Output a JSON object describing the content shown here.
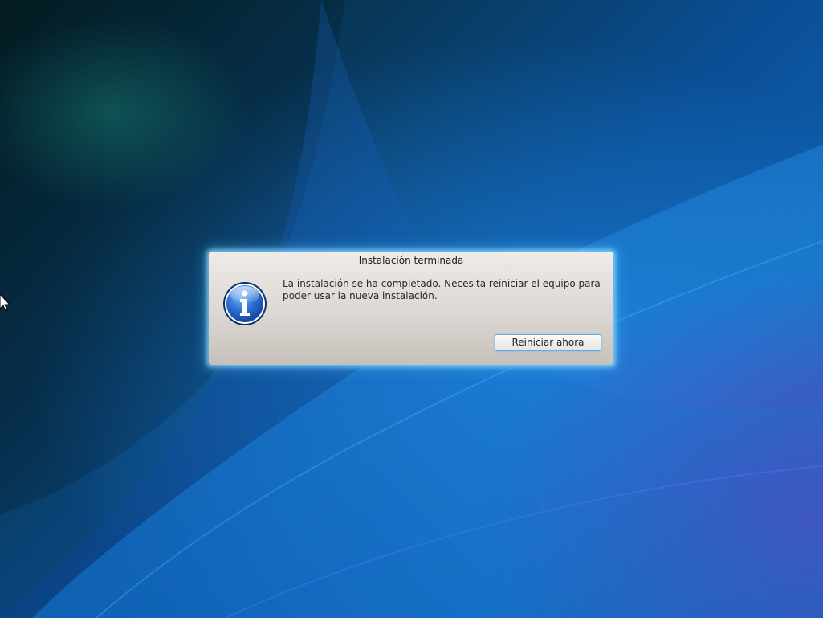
{
  "desktop": {
    "wallpaper": "blue-purple-abstract-wallpaper"
  },
  "dialog": {
    "title": "Instalación terminada",
    "message_line1": "La instalación se ha completado. Necesita reiniciar el equipo para",
    "message_line2": "poder usar la nueva instalación.",
    "icon": "info-icon",
    "restart_label": "Reiniciar ahora"
  },
  "colors": {
    "accent_glow": "#8cdcff",
    "icon_blue": "#1f5fbf",
    "dialog_bg": "#e4e0dc"
  }
}
